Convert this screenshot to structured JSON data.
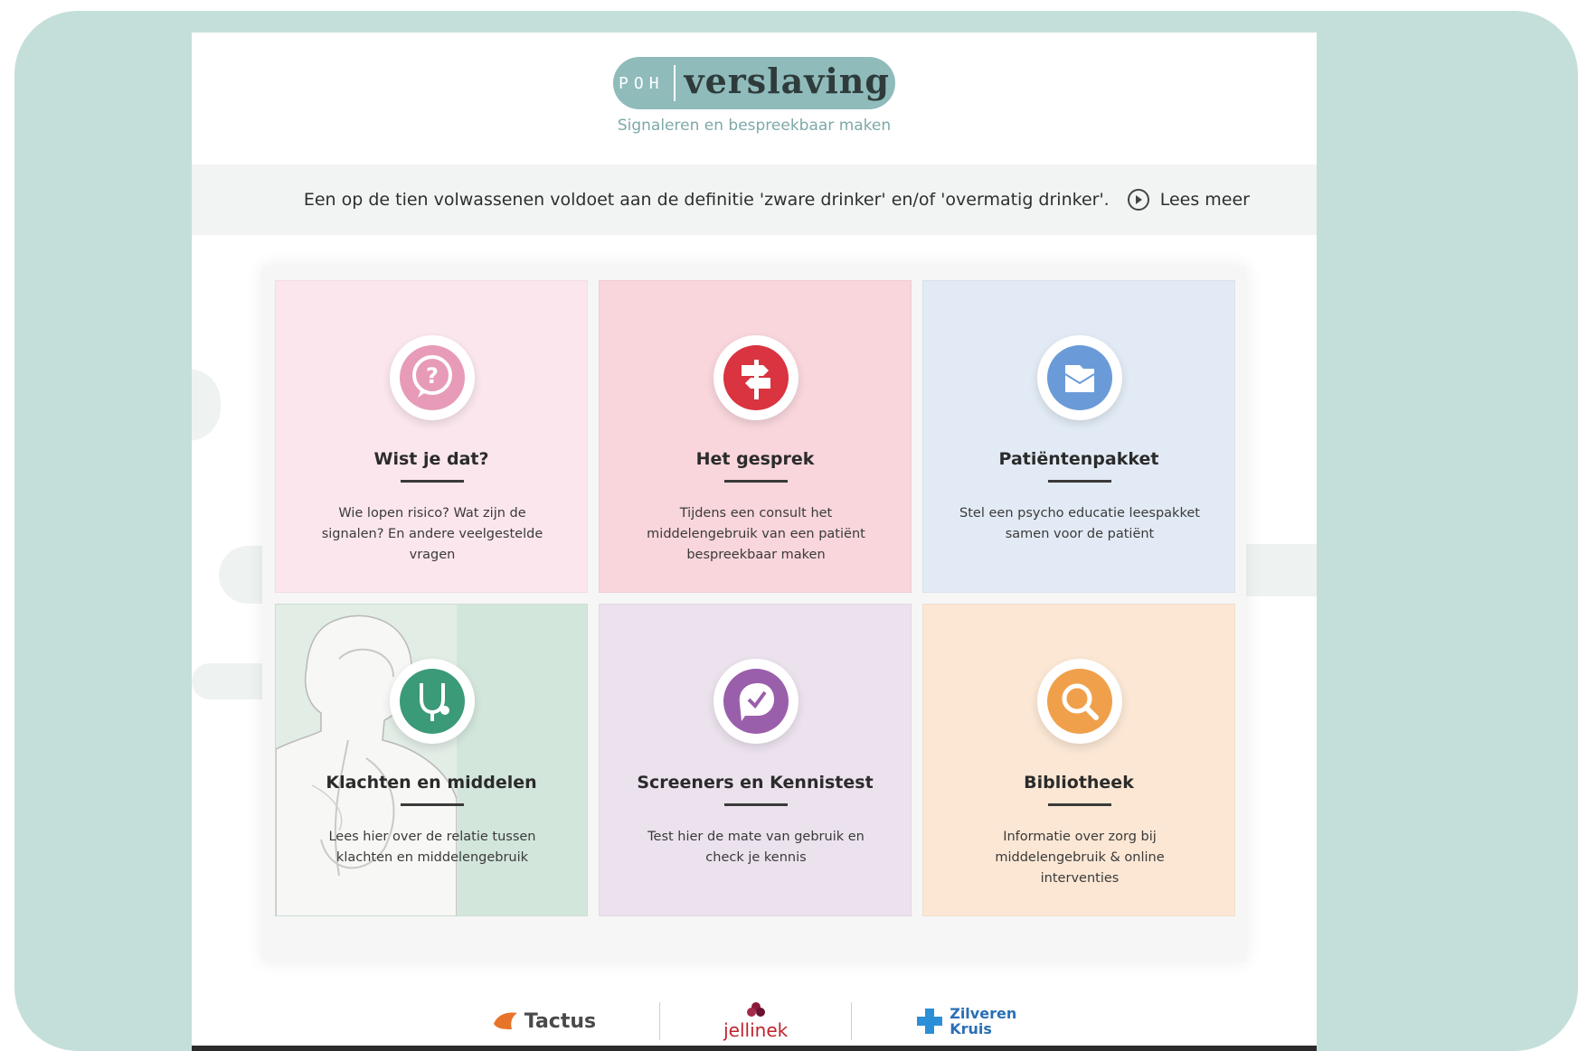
{
  "header": {
    "logo_prefix": "POH",
    "logo_word": "verslaving",
    "tagline": "Signaleren en bespreekbaar maken"
  },
  "banner": {
    "text": "Een op de tien volwassenen voldoet aan de definitie 'zware drinker' en/of 'overmatig drinker'.",
    "more_label": "Lees meer"
  },
  "cards": [
    {
      "title": "Wist je dat?",
      "description": "Wie lopen risico? Wat zijn de signalen? En andere veelgestelde vragen",
      "icon": "question-bubble-icon",
      "accent": "#e79bb8"
    },
    {
      "title": "Het gesprek",
      "description": "Tijdens een consult het middelengebruik van een patiënt bespreekbaar maken",
      "icon": "signpost-icon",
      "accent": "#d9343f"
    },
    {
      "title": "Patiëntenpakket",
      "description": "Stel een psycho educatie leespakket samen voor de patiënt",
      "icon": "folder-icon",
      "accent": "#6a9bd8"
    },
    {
      "title": "Klachten en middelen",
      "description": "Lees hier over de relatie tussen klachten en middelengebruik",
      "icon": "stethoscope-icon",
      "accent": "#3b9a77"
    },
    {
      "title": "Screeners en Kennistest",
      "description": "Test hier de mate van gebruik en check je kennis",
      "icon": "checklist-brain-icon",
      "accent": "#9a5fab"
    },
    {
      "title": "Bibliotheek",
      "description": "Informatie over zorg bij middelengebruik & online interventies",
      "icon": "magnifier-icon",
      "accent": "#f0a04b"
    }
  ],
  "partners": {
    "tactus": "Tactus",
    "jellinek": "jellinek",
    "zilveren_kruis_line1": "Zilveren",
    "zilveren_kruis_line2": "Kruis"
  },
  "colors": {
    "frame": "#c4dfda",
    "logo_pill": "#8fbbbb"
  }
}
